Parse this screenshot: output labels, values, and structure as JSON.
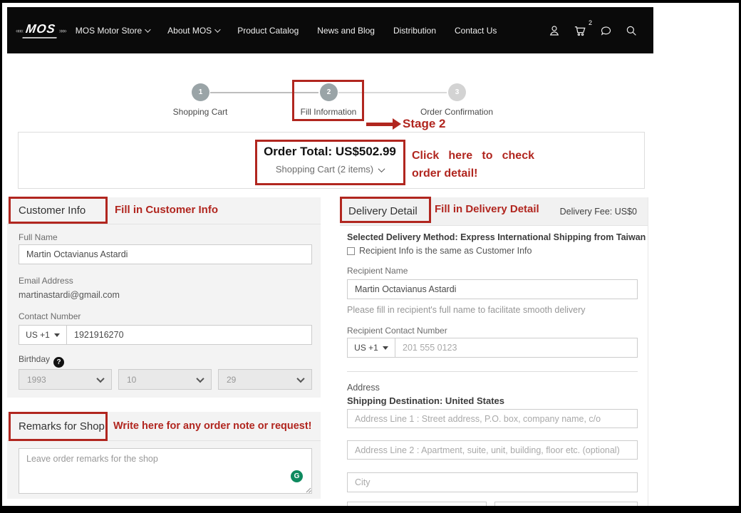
{
  "colors": {
    "annotation": "#b1261f",
    "step_active": "#9aa4a7",
    "step_inactive": "#d3d3d3",
    "grammarly": "#0e8a5f",
    "header_bg": "#0a0a0a"
  },
  "header": {
    "logo": "MOS",
    "logo_wing_left": "«««",
    "logo_wing_right": "»»»",
    "nav": [
      "MOS Motor Store",
      "About MOS",
      "Product Catalog",
      "News and Blog",
      "Distribution",
      "Contact Us"
    ],
    "cart_badge": "2"
  },
  "stepper": {
    "steps": [
      {
        "number": "1",
        "label": "Shopping Cart"
      },
      {
        "number": "2",
        "label": "Fill Information"
      },
      {
        "number": "3",
        "label": "Order Confirmation"
      }
    ]
  },
  "annotations": {
    "stage2": "Stage 2",
    "order_note": "Click here to check order detail!",
    "customer_note": "Fill in Customer Info",
    "remarks_note": "Write here for any order note or request!",
    "delivery_note": "Fill in Delivery Detail"
  },
  "order_summary": {
    "total": "Order Total: US$502.99",
    "cart_toggle": "Shopping Cart (2 items)"
  },
  "customer_info": {
    "title": "Customer Info",
    "full_name_label": "Full Name",
    "full_name_value": "Martin Octavianus Astardi",
    "email_label": "Email Address",
    "email_value": "martinastardi@gmail.com",
    "contact_label": "Contact Number",
    "country_code": "US +1",
    "phone_value": "1921916270",
    "birthday_label": "Birthday",
    "birthday_help_glyph": "?",
    "birthday_year": "1993",
    "birthday_month": "10",
    "birthday_day": "29"
  },
  "remarks": {
    "title": "Remarks for Shop",
    "placeholder": "Leave order remarks for the shop",
    "grammarly_glyph": "G"
  },
  "delivery": {
    "title": "Delivery Detail",
    "fee": "Delivery Fee: US$0",
    "method": "Selected Delivery Method: Express International Shipping from Taiwan",
    "same_as_customer": "Recipient Info is the same as Customer Info",
    "recipient_name_label": "Recipient Name",
    "recipient_name_value": "Martin Octavianus Astardi",
    "recipient_name_hint": "Please fill in recipient's full name to facilitate smooth delivery",
    "recipient_contact_label": "Recipient Contact Number",
    "country_code": "US +1",
    "phone_placeholder": "201 555 0123",
    "address_label": "Address",
    "shipping_destination": "Shipping Destination: United States",
    "address1_placeholder": "Address Line 1 : Street address, P.O. box, company name, c/o",
    "address2_placeholder": "Address Line 2 : Apartment, suite, unit, building, floor etc. (optional)",
    "city_placeholder": "City"
  }
}
